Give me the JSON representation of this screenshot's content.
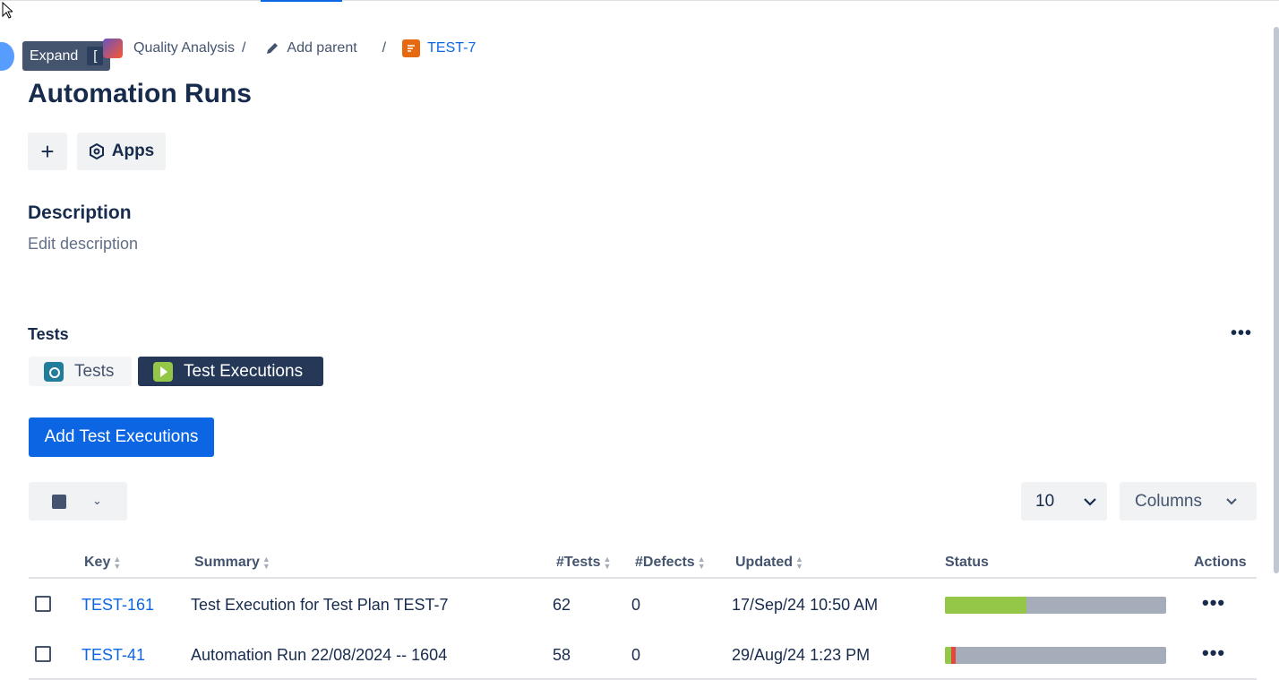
{
  "tooltip": {
    "label": "Expand",
    "shortcut": "["
  },
  "breadcrumb": {
    "project": "Quality Analysis",
    "separator": "/",
    "parent": "Add parent",
    "issue_key": "TEST-7"
  },
  "page_title": "Automation Runs",
  "toolbar": {
    "add_symbol": "+",
    "apps_label": "Apps"
  },
  "description": {
    "heading": "Description",
    "placeholder": "Edit description"
  },
  "tests_panel": {
    "heading": "Tests",
    "more_symbol": "•••",
    "tabs": [
      {
        "label": "Tests",
        "active": false
      },
      {
        "label": "Test Executions",
        "active": true
      }
    ],
    "add_button": "Add Test Executions",
    "page_size": "10",
    "columns_label": "Columns",
    "table": {
      "headers": [
        "Key",
        "Summary",
        "#Tests",
        "#Defects",
        "Updated",
        "Status",
        "Actions"
      ],
      "rows": [
        {
          "key": "TEST-161",
          "summary": "Test Execution for Test Plan TEST-7",
          "tests": "62",
          "defects": "0",
          "updated": "17/Sep/24 10:50 AM",
          "pass_fraction": 0.37,
          "fail_fraction": 0.0,
          "actions": "•••"
        },
        {
          "key": "TEST-41",
          "summary": "Automation Run 22/08/2024 -- 1604",
          "tests": "58",
          "defects": "0",
          "updated": "29/Aug/24 1:23 PM",
          "pass_fraction": 0.03,
          "fail_fraction": 0.02,
          "actions": "•••"
        }
      ]
    }
  },
  "colors": {
    "primary": "#0c66e4",
    "pass": "#94c748",
    "fail": "#e2483d",
    "todo": "#a5adba",
    "dark_tab": "#253858"
  }
}
